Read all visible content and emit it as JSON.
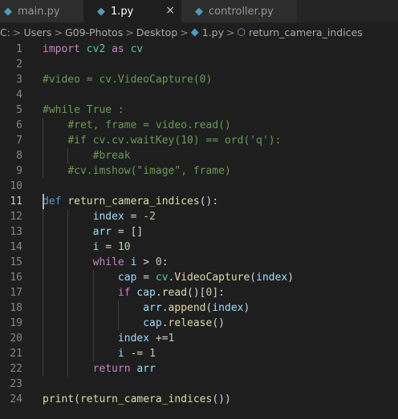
{
  "tabs": [
    {
      "label": "main.py",
      "active": false
    },
    {
      "label": "1.py",
      "active": true
    },
    {
      "label": "controller.py",
      "active": false
    }
  ],
  "tab_close_glyph": "×",
  "breadcrumb": {
    "items": [
      "C:",
      "Users",
      "G09-Photos",
      "Desktop",
      "1.py",
      "return_camera_indices"
    ],
    "separator": ">"
  },
  "editor": {
    "current_line": 11,
    "line_numbers": [
      "1",
      "2",
      "3",
      "4",
      "5",
      "6",
      "7",
      "8",
      "9",
      "10",
      "11",
      "12",
      "13",
      "14",
      "15",
      "16",
      "17",
      "18",
      "19",
      "20",
      "21",
      "22",
      "23",
      "24"
    ],
    "lines": [
      [
        {
          "t": "import",
          "c": "t-ctl"
        },
        {
          "t": " ",
          "c": "t-pl"
        },
        {
          "t": "cv2",
          "c": "t-mod"
        },
        {
          "t": " ",
          "c": "t-pl"
        },
        {
          "t": "as",
          "c": "t-ctl"
        },
        {
          "t": " ",
          "c": "t-pl"
        },
        {
          "t": "cv",
          "c": "t-mod"
        }
      ],
      [],
      [
        {
          "t": "#video = cv.VideoCapture(0)",
          "c": "t-cm"
        }
      ],
      [],
      [
        {
          "t": "#while True :",
          "c": "t-cm"
        }
      ],
      [
        {
          "t": "    ",
          "c": "t-pl"
        },
        {
          "t": "#ret, frame = video.read()",
          "c": "t-cm"
        }
      ],
      [
        {
          "t": "    ",
          "c": "t-pl"
        },
        {
          "t": "#if cv.cv.waitKey(10) == ord('q'):",
          "c": "t-cm"
        }
      ],
      [
        {
          "t": "        ",
          "c": "t-pl"
        },
        {
          "t": "#break",
          "c": "t-cm"
        }
      ],
      [
        {
          "t": "    ",
          "c": "t-pl"
        },
        {
          "t": "#cv.imshow(\"image\", frame)",
          "c": "t-cm"
        }
      ],
      [],
      [
        {
          "t": "def",
          "c": "t-kw"
        },
        {
          "t": " ",
          "c": "t-pl"
        },
        {
          "t": "return_camera_indices",
          "c": "t-fn"
        },
        {
          "t": "():",
          "c": "t-pl"
        }
      ],
      [
        {
          "t": "        ",
          "c": "t-pl"
        },
        {
          "t": "index",
          "c": "t-var"
        },
        {
          "t": " = ",
          "c": "t-pl"
        },
        {
          "t": "-2",
          "c": "t-num"
        }
      ],
      [
        {
          "t": "        ",
          "c": "t-pl"
        },
        {
          "t": "arr",
          "c": "t-var"
        },
        {
          "t": " = []",
          "c": "t-pl"
        }
      ],
      [
        {
          "t": "        ",
          "c": "t-pl"
        },
        {
          "t": "i",
          "c": "t-var"
        },
        {
          "t": " = ",
          "c": "t-pl"
        },
        {
          "t": "10",
          "c": "t-num"
        }
      ],
      [
        {
          "t": "        ",
          "c": "t-pl"
        },
        {
          "t": "while",
          "c": "t-ctl"
        },
        {
          "t": " ",
          "c": "t-pl"
        },
        {
          "t": "i",
          "c": "t-var"
        },
        {
          "t": " > ",
          "c": "t-pl"
        },
        {
          "t": "0",
          "c": "t-num"
        },
        {
          "t": ":",
          "c": "t-pl"
        }
      ],
      [
        {
          "t": "            ",
          "c": "t-pl"
        },
        {
          "t": "cap",
          "c": "t-var"
        },
        {
          "t": " = ",
          "c": "t-pl"
        },
        {
          "t": "cv",
          "c": "t-mod"
        },
        {
          "t": ".",
          "c": "t-pl"
        },
        {
          "t": "VideoCapture",
          "c": "t-fn"
        },
        {
          "t": "(",
          "c": "t-pl"
        },
        {
          "t": "index",
          "c": "t-var"
        },
        {
          "t": ")",
          "c": "t-pl"
        }
      ],
      [
        {
          "t": "            ",
          "c": "t-pl"
        },
        {
          "t": "if",
          "c": "t-ctl"
        },
        {
          "t": " ",
          "c": "t-pl"
        },
        {
          "t": "cap",
          "c": "t-var"
        },
        {
          "t": ".",
          "c": "t-pl"
        },
        {
          "t": "read",
          "c": "t-fn"
        },
        {
          "t": "()[",
          "c": "t-pl"
        },
        {
          "t": "0",
          "c": "t-num"
        },
        {
          "t": "]:",
          "c": "t-pl"
        }
      ],
      [
        {
          "t": "                ",
          "c": "t-pl"
        },
        {
          "t": "arr",
          "c": "t-var"
        },
        {
          "t": ".",
          "c": "t-pl"
        },
        {
          "t": "append",
          "c": "t-fn"
        },
        {
          "t": "(",
          "c": "t-pl"
        },
        {
          "t": "index",
          "c": "t-var"
        },
        {
          "t": ")",
          "c": "t-pl"
        }
      ],
      [
        {
          "t": "                ",
          "c": "t-pl"
        },
        {
          "t": "cap",
          "c": "t-var"
        },
        {
          "t": ".",
          "c": "t-pl"
        },
        {
          "t": "release",
          "c": "t-fn"
        },
        {
          "t": "()",
          "c": "t-pl"
        }
      ],
      [
        {
          "t": "            ",
          "c": "t-pl"
        },
        {
          "t": "index",
          "c": "t-var"
        },
        {
          "t": " +=",
          "c": "t-pl"
        },
        {
          "t": "1",
          "c": "t-num"
        }
      ],
      [
        {
          "t": "            ",
          "c": "t-pl"
        },
        {
          "t": "i",
          "c": "t-var"
        },
        {
          "t": " -= ",
          "c": "t-pl"
        },
        {
          "t": "1",
          "c": "t-num"
        }
      ],
      [
        {
          "t": "        ",
          "c": "t-pl"
        },
        {
          "t": "return",
          "c": "t-ctl"
        },
        {
          "t": " ",
          "c": "t-pl"
        },
        {
          "t": "arr",
          "c": "t-var"
        }
      ],
      [],
      [
        {
          "t": "print",
          "c": "t-fn"
        },
        {
          "t": "(",
          "c": "t-pl"
        },
        {
          "t": "return_camera_indices",
          "c": "t-fn"
        },
        {
          "t": "())",
          "c": "t-pl"
        }
      ]
    ]
  }
}
